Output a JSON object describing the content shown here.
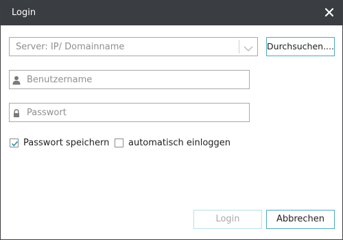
{
  "window": {
    "title": "Login"
  },
  "server": {
    "placeholder": "Server: IP/ Domainname"
  },
  "browse_label": "Durchsuchen....",
  "username": {
    "placeholder": "Benutzername"
  },
  "password": {
    "placeholder": "Passwort"
  },
  "options": {
    "save_password": {
      "label": "Passwort speichern",
      "checked": true
    },
    "auto_login": {
      "label": "automatisch einloggen",
      "checked": false
    }
  },
  "buttons": {
    "login": "Login",
    "cancel": "Abbrechen"
  },
  "colors": {
    "titlebar": "#3a3d41",
    "accent": "#4aa8b8",
    "check": "#3a9ab0"
  },
  "icons": {
    "close": "close-icon",
    "dropdown": "chevron-down-icon",
    "user": "user-icon",
    "lock": "lock-icon",
    "check": "checkmark-icon"
  }
}
